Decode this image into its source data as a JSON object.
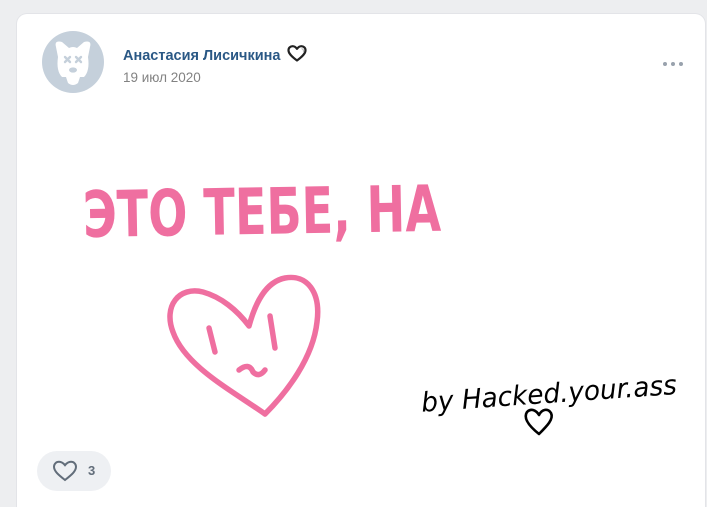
{
  "post": {
    "author_name": "Анастасия Лисичкина",
    "date": "19 июл 2020",
    "image_text_line1": "ЭТО ТЕБЕ, НА",
    "image_signature": "by Hacked.your.ass",
    "likes_count": "3"
  },
  "icons": {
    "avatar": "deactivated-dog-icon",
    "author_badge": "heart-outline-icon",
    "more": "more-horizontal-icon",
    "like": "heart-outline-icon"
  },
  "colors": {
    "page_bg": "#edeef0",
    "card_bg": "#ffffff",
    "author_link": "#2a5885",
    "date_text": "#828282",
    "drawing_pink": "#ef6fa0",
    "drawing_black": "#000000",
    "like_bg": "#eef0f3"
  }
}
